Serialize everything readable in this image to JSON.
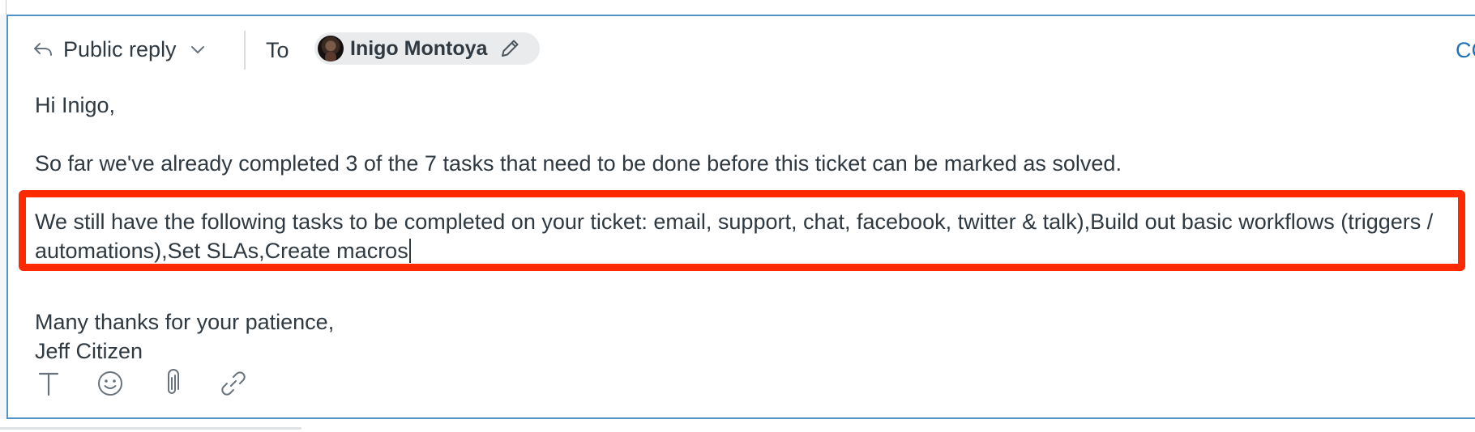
{
  "header": {
    "reply_type_label": "Public reply",
    "to_label": "To",
    "recipient_name": "Inigo Montoya",
    "cc_label": "CC"
  },
  "message": {
    "greeting": "Hi Inigo,",
    "progress": "So far we've already completed 3 of the 7 tasks that need to be done before this ticket can be marked as solved.",
    "remaining_tasks": "We still have the following tasks to be completed on your ticket: email, support, chat, facebook, twitter & talk),Build out basic workflows (triggers / automations),Set SLAs,Create macros",
    "closing": "Many thanks for your patience,",
    "signature": "Jeff Citizen"
  },
  "toolbar": {
    "icons": [
      "text-format-icon",
      "emoji-icon",
      "attachment-icon",
      "link-icon"
    ]
  },
  "colors": {
    "focus_border": "#5293c7",
    "highlight": "#ff2a00",
    "link": "#1f73b7",
    "text": "#2f3941",
    "pill_bg": "#e9ebed"
  }
}
